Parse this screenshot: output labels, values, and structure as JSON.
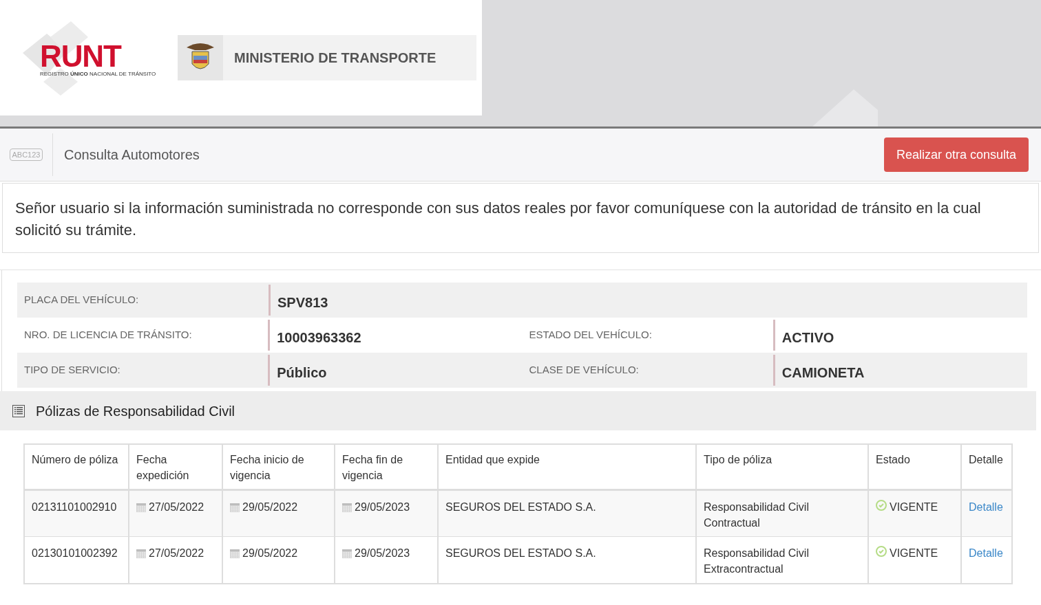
{
  "header": {
    "logo": {
      "word": "RUNT",
      "tagline_before": "REGISTRO ",
      "tagline_bold": "ÚNICO",
      "tagline_after": " NACIONAL DE TRÁNSITO"
    },
    "ministry": "MINISTERIO DE TRANSPORTE"
  },
  "toolbar": {
    "badge": "ABC123",
    "title": "Consulta Automotores",
    "button": "Realizar otra consulta"
  },
  "notice": "Señor usuario si la información suministrada no corresponde con sus datos reales por favor comuníquese con la autoridad de tránsito en la cual solicitó su trámite.",
  "vehicle": [
    [
      {
        "label": "PLACA DEL VEHÍCULO:",
        "value": "SPV813"
      }
    ],
    [
      {
        "label": "NRO. DE LICENCIA DE TRÁNSITO:",
        "value": "10003963362"
      },
      {
        "label": "ESTADO DEL VEHÍCULO:",
        "value": "ACTIVO"
      }
    ],
    [
      {
        "label": "TIPO DE SERVICIO:",
        "value": "Público"
      },
      {
        "label": "CLASE DE VEHÍCULO:",
        "value": "CAMIONETA"
      }
    ]
  ],
  "policies": {
    "title": "Pólizas de Responsabilidad Civil",
    "columns": [
      "Número de póliza",
      "Fecha expedición",
      "Fecha inicio de vigencia",
      "Fecha fin de vigencia",
      "Entidad que expide",
      "Tipo de póliza",
      "Estado",
      "Detalle"
    ],
    "rows": [
      {
        "number": "02131101002910",
        "issued": "27/05/2022",
        "start": "29/05/2022",
        "end": "29/05/2023",
        "entity": "SEGUROS DEL ESTADO S.A.",
        "type": "Responsabilidad Civil Contractual",
        "status": "VIGENTE",
        "detail": "Detalle"
      },
      {
        "number": "02130101002392",
        "issued": "27/05/2022",
        "start": "29/05/2022",
        "end": "29/05/2023",
        "entity": "SEGUROS DEL ESTADO S.A.",
        "type": "Responsabilidad Civil Extracontractual",
        "status": "VIGENTE",
        "detail": "Detalle"
      }
    ]
  }
}
